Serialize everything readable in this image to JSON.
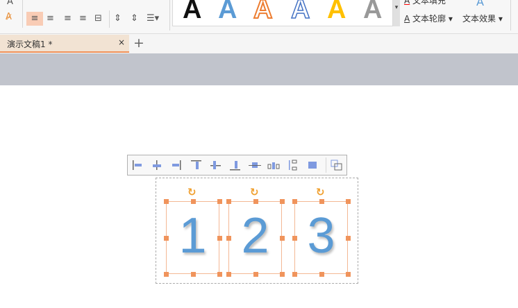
{
  "ribbon": {
    "text_fill": "文本填充",
    "text_outline": "文本轮廓",
    "text_effect": "文本效果",
    "wordart_styles": [
      "A",
      "A",
      "A",
      "A",
      "A",
      "A"
    ],
    "wordart_colors": [
      "#111111",
      "#5b9bd5",
      "#ed7d31",
      "#4472c4",
      "#ffc000",
      "#666666"
    ]
  },
  "tabs": [
    {
      "label": "演示文稿1 *",
      "active": true
    }
  ],
  "new_tab": "+",
  "close_tab": "×",
  "slide": {
    "textboxes": [
      {
        "text": "1"
      },
      {
        "text": "2"
      },
      {
        "text": "3"
      }
    ]
  },
  "accent": "#ef9158"
}
